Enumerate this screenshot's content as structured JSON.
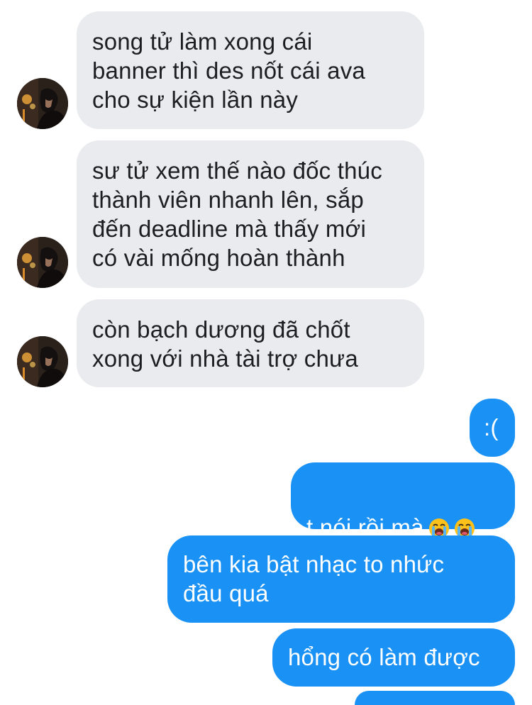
{
  "messages": [
    {
      "side": "in",
      "text": "song tử làm xong cái\nbanner thì des nốt cái ava\ncho sự kiện lần này"
    },
    {
      "side": "in",
      "text": "sư tử xem thế nào đốc thúc\nthành viên nhanh lên, sắp\nđến deadline mà thấy mới\ncó vài mống hoàn thành"
    },
    {
      "side": "in",
      "text": "còn bạch dương đã chốt\nxong với nhà tài trợ chưa"
    },
    {
      "side": "out",
      "text": ":("
    },
    {
      "side": "out",
      "text": "t nói rồi mà",
      "emojis": [
        "loudly-crying-face-icon",
        "loudly-crying-face-icon"
      ]
    },
    {
      "side": "out",
      "text": "bên kia bật nhạc to nhức\nđầu quá"
    },
    {
      "side": "out",
      "text": "hổng có làm được"
    }
  ],
  "colors": {
    "incoming_bubble": "#e9ebee",
    "outgoing_bubble": "#1a91f5",
    "incoming_text": "#1c1e21",
    "outgoing_text": "#ffffff"
  }
}
